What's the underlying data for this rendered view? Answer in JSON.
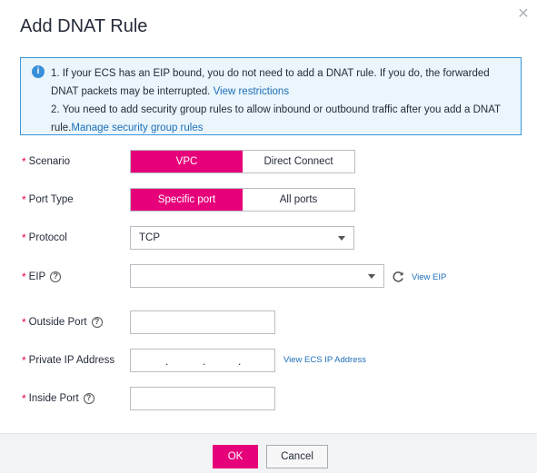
{
  "dialog": {
    "title": "Add DNAT Rule",
    "close_icon": "close-icon"
  },
  "notice": {
    "line1": "1. If your ECS has an EIP bound, you do not need to add a DNAT rule. If you do, the forwarded DNAT packets may be interrupted.",
    "line1_link": "View restrictions",
    "line2": "2. You need to add security group rules to allow inbound or outbound traffic after you add a DNAT rule.",
    "line2_link": "Manage security group rules"
  },
  "form": {
    "required_mark": "*",
    "scenario": {
      "label": "Scenario",
      "options": [
        "VPC",
        "Direct Connect"
      ],
      "selected": "VPC"
    },
    "port_type": {
      "label": "Port Type",
      "options": [
        "Specific port",
        "All ports"
      ],
      "selected": "Specific port"
    },
    "protocol": {
      "label": "Protocol",
      "value": "TCP"
    },
    "eip": {
      "label": "EIP",
      "value": "",
      "link": "View EIP"
    },
    "outside_port": {
      "label": "Outside Port",
      "value": ""
    },
    "private_ip": {
      "label": "Private IP Address",
      "dots": [
        ".",
        ".",
        "."
      ],
      "link": "View ECS IP Address"
    },
    "inside_port": {
      "label": "Inside Port",
      "value": ""
    }
  },
  "footer": {
    "ok_label": "OK",
    "cancel_label": "Cancel"
  },
  "colors": {
    "accent": "#e6007a",
    "link": "#1d6fb8",
    "notice_border": "#3b96d8",
    "notice_bg": "#eaf5fc"
  }
}
